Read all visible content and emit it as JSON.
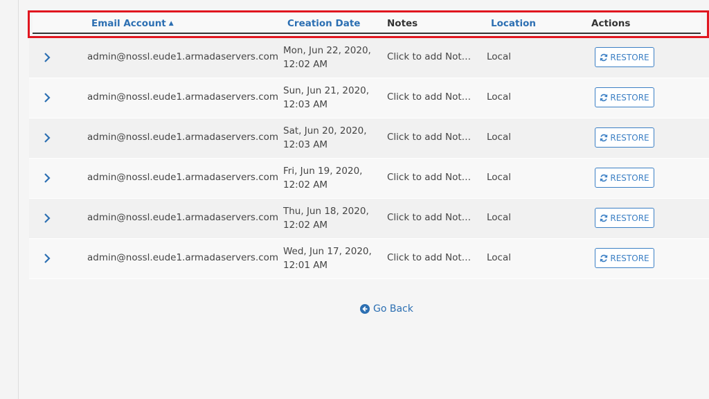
{
  "table": {
    "headers": {
      "email": "Email Account",
      "date": "Creation Date",
      "notes": "Notes",
      "location": "Location",
      "actions": "Actions"
    },
    "sort_indicator": "ascending",
    "rows": [
      {
        "email": "admin@nossl.eude1.armadaservers.com",
        "date_line1": "Mon, Jun 22, 2020,",
        "date_line2": "12:02 AM",
        "notes": "Click to add Note...",
        "location": "Local",
        "action": "RESTORE"
      },
      {
        "email": "admin@nossl.eude1.armadaservers.com",
        "date_line1": "Sun, Jun 21, 2020,",
        "date_line2": "12:03 AM",
        "notes": "Click to add Note...",
        "location": "Local",
        "action": "RESTORE"
      },
      {
        "email": "admin@nossl.eude1.armadaservers.com",
        "date_line1": "Sat, Jun 20, 2020,",
        "date_line2": "12:03 AM",
        "notes": "Click to add Note...",
        "location": "Local",
        "action": "RESTORE"
      },
      {
        "email": "admin@nossl.eude1.armadaservers.com",
        "date_line1": "Fri, Jun 19, 2020,",
        "date_line2": "12:02 AM",
        "notes": "Click to add Note...",
        "location": "Local",
        "action": "RESTORE"
      },
      {
        "email": "admin@nossl.eude1.armadaservers.com",
        "date_line1": "Thu, Jun 18, 2020,",
        "date_line2": "12:02 AM",
        "notes": "Click to add Note...",
        "location": "Local",
        "action": "RESTORE"
      },
      {
        "email": "admin@nossl.eude1.armadaservers.com",
        "date_line1": "Wed, Jun 17, 2020,",
        "date_line2": "12:01 AM",
        "notes": "Click to add Note...",
        "location": "Local",
        "action": "RESTORE"
      }
    ]
  },
  "footer": {
    "go_back": "Go Back"
  },
  "icons": {
    "expand": "chevron-right-icon",
    "restore": "refresh-icon",
    "back": "arrow-circle-left-icon",
    "sort": "caret-up-icon"
  },
  "colors": {
    "link": "#2c6fb2",
    "highlight": "#e0161f",
    "text": "#444444"
  }
}
